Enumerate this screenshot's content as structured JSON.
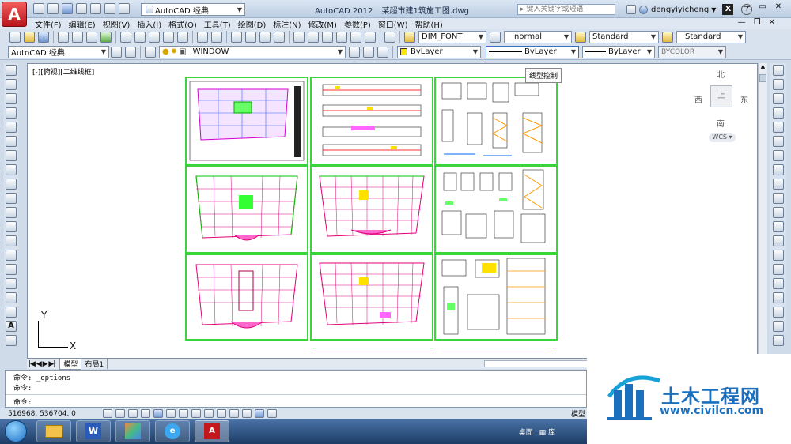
{
  "title_bar": {
    "workspace": "AutoCAD 经典",
    "app_title": "AutoCAD 2012",
    "file_name": "某超市建1筑施工图.dwg",
    "search_placeholder": "键入关键字或短语",
    "user": "dengyiyicheng",
    "help_glyph": "?"
  },
  "menu": [
    "文件(F)",
    "编辑(E)",
    "视图(V)",
    "插入(I)",
    "格式(O)",
    "工具(T)",
    "绘图(D)",
    "标注(N)",
    "修改(M)",
    "参数(P)",
    "窗口(W)",
    "帮助(H)"
  ],
  "styles_toolbar": {
    "text_style": "DIM_FONT",
    "dim_style": "normal",
    "table_style": "Standard",
    "multileader_style": "Standard"
  },
  "layers_toolbar": {
    "workspace": "AutoCAD 经典",
    "layer": "WINDOW",
    "color": "ByLayer",
    "linetype": "ByLayer",
    "lineweight": "ByLayer",
    "plotstyle": "BYCOLOR"
  },
  "tooltip": "线型控制",
  "viewport": {
    "label": "[-][俯视][二维线框]",
    "viewcube": {
      "north": "北",
      "south": "南",
      "east": "东",
      "west": "西",
      "face": "上",
      "wcs": "WCS"
    },
    "ucs": {
      "x": "X",
      "y": "Y"
    }
  },
  "layout_tabs": {
    "nav": "|◀ ◀ ▶ ▶|",
    "model": "模型",
    "layout1": "布局1"
  },
  "command": {
    "lines": [
      "命令: _options",
      "命令:"
    ],
    "prompt": "命令:"
  },
  "status": {
    "coords": "516968,  536704,  0",
    "model": "模型"
  },
  "taskbar": {
    "desktop": "桌面",
    "lib": "库"
  },
  "watermark": {
    "name": "土木工程网",
    "url": "www.civilcn.com"
  },
  "colors": {
    "sheet_border": "#3ad53a",
    "titlebar": "#c7d6e8",
    "taskbar": "#2b4f7e",
    "accent_red": "#d4242b"
  }
}
